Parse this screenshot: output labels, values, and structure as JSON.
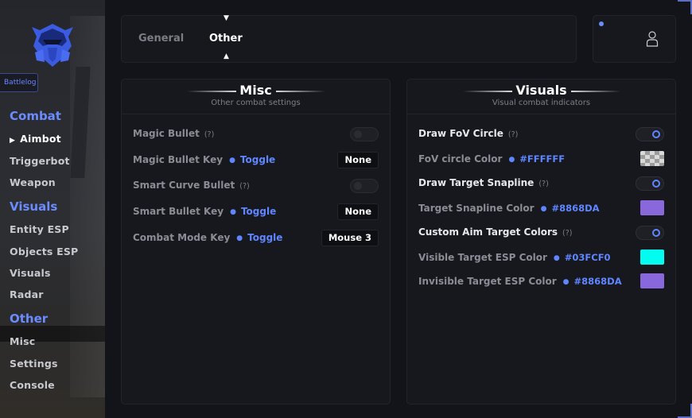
{
  "brand": {
    "name": "Battlelog"
  },
  "sidebar": {
    "sections": [
      {
        "title": "Combat",
        "items": [
          {
            "label": "Aimbot",
            "active": true
          },
          {
            "label": "Triggerbot"
          },
          {
            "label": "Weapon"
          }
        ]
      },
      {
        "title": "Visuals",
        "items": [
          {
            "label": "Entity ESP"
          },
          {
            "label": "Objects ESP"
          },
          {
            "label": "Visuals"
          },
          {
            "label": "Radar"
          }
        ]
      },
      {
        "title": "Other",
        "items": [
          {
            "label": "Misc"
          },
          {
            "label": "Settings"
          },
          {
            "label": "Console"
          }
        ]
      }
    ]
  },
  "tabs": [
    {
      "label": "General"
    },
    {
      "label": "Other",
      "active": true
    }
  ],
  "icons": {
    "tab_marker": "▼",
    "tab_marker_up": "▲",
    "nav_arrow": "▶",
    "user": "user-icon"
  },
  "misc": {
    "title": "Misc",
    "subtitle": "Other combat settings",
    "rows": {
      "magic_bullet": {
        "label": "Magic Bullet",
        "help": "(?)",
        "enabled": false
      },
      "magic_bullet_key": {
        "label": "Magic Bullet Key",
        "mode": "Toggle",
        "key": "None"
      },
      "smart_curve_bullet": {
        "label": "Smart Curve Bullet",
        "help": "(?)",
        "enabled": false
      },
      "smart_bullet_key": {
        "label": "Smart Bullet Key",
        "mode": "Toggle",
        "key": "None"
      },
      "combat_mode_key": {
        "label": "Combat Mode Key",
        "mode": "Toggle",
        "key": "Mouse 3"
      }
    }
  },
  "visuals": {
    "title": "Visuals",
    "subtitle": "Visual combat indicators",
    "rows": {
      "draw_fov": {
        "label": "Draw FoV Circle",
        "help": "(?)",
        "enabled": true
      },
      "fov_color": {
        "label": "FoV circle Color",
        "value": "#FFFFFF"
      },
      "draw_snapline": {
        "label": "Draw Target Snapline",
        "help": "(?)",
        "enabled": true
      },
      "snapline_color": {
        "label": "Target Snapline Color",
        "value": "#8868DA"
      },
      "custom_aim": {
        "label": "Custom Aim Target Colors",
        "help": "(?)",
        "enabled": true
      },
      "visible_esp": {
        "label": "Visible Target ESP Color",
        "value": "#03FCF0"
      },
      "invisible_esp": {
        "label": "Invisible Target ESP Color",
        "value": "#8868DA"
      }
    }
  },
  "colors": {
    "accent": "#5f86ff",
    "snapline": "#8868DA",
    "visible": "#03FCF0",
    "invisible": "#8868DA"
  }
}
